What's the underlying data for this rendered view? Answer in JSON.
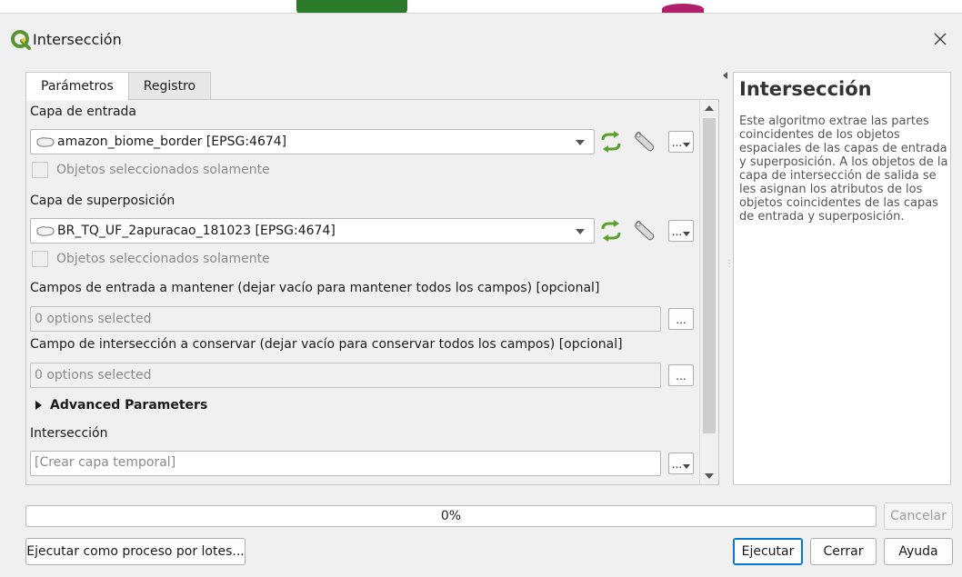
{
  "window": {
    "title": "Intersección",
    "close_icon": "close-icon"
  },
  "tabs": [
    {
      "label": "Parámetros",
      "active": true
    },
    {
      "label": "Registro",
      "active": false
    }
  ],
  "params": {
    "input_layer": {
      "label": "Capa de entrada",
      "value": "amazon_biome_border [EPSG:4674]",
      "selected_only_label": "Objetos seleccionados solamente"
    },
    "overlay_layer": {
      "label": "Capa de superposición",
      "value": "BR_TQ_UF_2apuracao_181023 [EPSG:4674]",
      "selected_only_label": "Objetos seleccionados solamente"
    },
    "input_fields": {
      "label": "Campos de entrada a mantener (dejar vacío para mantener todos los campos) [opcional]",
      "value": "0 options selected",
      "button": "..."
    },
    "overlay_fields": {
      "label": "Campo de intersección a conservar (dejar vacío para conservar todos los campos) [opcional]",
      "value": "0 options selected",
      "button": "..."
    },
    "advanced_label": "Advanced Parameters",
    "output": {
      "label": "Intersección",
      "placeholder": "[Crear capa temporal]"
    }
  },
  "help": {
    "title": "Intersección",
    "body": "Este algoritmo extrae las partes coincidentes de los objetos espaciales de las capas de entrada y superposición. A los objetos de la capa de intersección de salida se les asignan los atributos de los objetos coincidentes de las capas de entrada y superposición."
  },
  "progress": {
    "value": 0,
    "text": "0%"
  },
  "buttons": {
    "cancel": "Cancelar",
    "batch": "Ejecutar como proceso por lotes...",
    "run": "Ejecutar",
    "close": "Cerrar",
    "help": "Ayuda"
  },
  "colors": {
    "accent": "#0078d4",
    "qgis_green": "#589632",
    "qgis_yellow": "#f0c419",
    "iterate_green": "#5aa02c"
  }
}
